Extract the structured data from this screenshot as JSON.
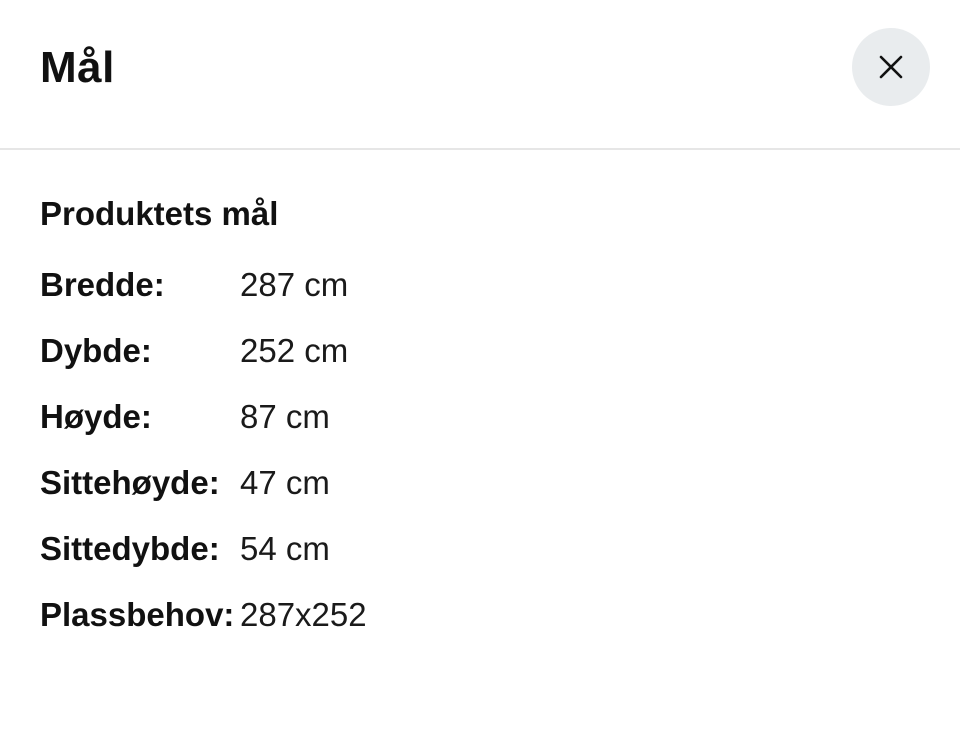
{
  "dialog": {
    "title": "Mål",
    "close_icon": "close-icon"
  },
  "section": {
    "title": "Produktets mål",
    "rows": [
      {
        "label": "Bredde:",
        "value": "287 cm"
      },
      {
        "label": "Dybde:",
        "value": "252 cm"
      },
      {
        "label": "Høyde:",
        "value": "87 cm"
      },
      {
        "label": "Sittehøyde:",
        "value": "47 cm"
      },
      {
        "label": "Sittedybde:",
        "value": "54 cm"
      },
      {
        "label": "Plassbehov:",
        "value": "287x252"
      }
    ]
  },
  "colors": {
    "close_button_bg": "#e9ecee",
    "divider": "#e6e6e6",
    "text": "#111111"
  }
}
